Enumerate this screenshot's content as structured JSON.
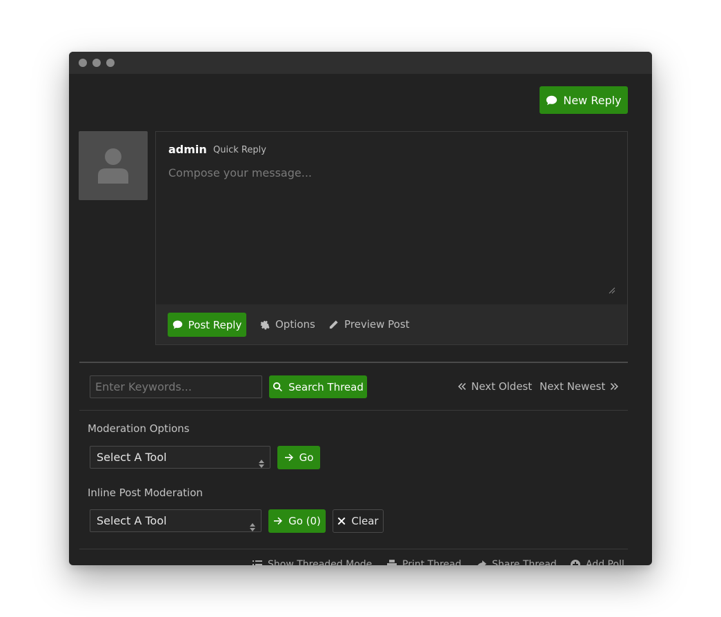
{
  "toolbar": {
    "new_reply_label": "New Reply"
  },
  "quick_reply": {
    "username": "admin",
    "subtitle": "Quick Reply",
    "placeholder": "Compose your message...",
    "post_reply_label": "Post Reply",
    "options_label": "Options",
    "preview_label": "Preview Post"
  },
  "search": {
    "placeholder": "Enter Keywords...",
    "button_label": "Search Thread"
  },
  "navigation": {
    "next_oldest": "Next Oldest",
    "next_newest": "Next Newest"
  },
  "moderation": {
    "label": "Moderation Options",
    "select_value": "Select A Tool",
    "go_label": "Go"
  },
  "inline_moderation": {
    "label": "Inline Post Moderation",
    "select_value": "Select A Tool",
    "go_label": "Go (0)",
    "clear_label": "Clear"
  },
  "footer": {
    "threaded_mode": "Show Threaded Mode",
    "print_thread": "Print Thread",
    "share_thread": "Share Thread",
    "add_poll": "Add Poll"
  },
  "colors": {
    "accent": "#2b8a12",
    "background": "#222222",
    "text_muted": "#bdbdbd"
  }
}
